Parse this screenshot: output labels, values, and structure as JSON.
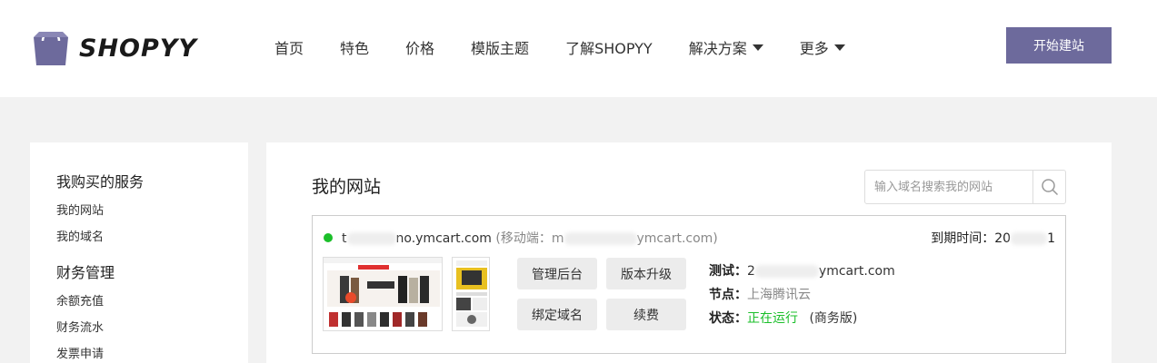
{
  "brand": {
    "name": "SHOPYY",
    "accent": "#6d6a9c"
  },
  "nav": {
    "items": [
      {
        "label": "首页"
      },
      {
        "label": "特色"
      },
      {
        "label": "价格"
      },
      {
        "label": "模版主题"
      },
      {
        "label": "了解SHOPYY"
      },
      {
        "label": "解决方案",
        "dropdown": true
      },
      {
        "label": "更多",
        "dropdown": true
      }
    ],
    "cta_label": "开始建站"
  },
  "sidebar": {
    "groups": [
      {
        "title": "我购买的服务",
        "links": [
          "我的网站",
          "我的域名"
        ]
      },
      {
        "title": "财务管理",
        "links": [
          "余额充值",
          "财务流水",
          "发票申请"
        ]
      }
    ]
  },
  "main": {
    "title": "我的网站",
    "search": {
      "placeholder": "输入域名搜索我的网站",
      "icon": "search-icon"
    },
    "site": {
      "domain_prefix": "t",
      "domain_suffix": "no.ymcart.com",
      "mobile_prefix": "(移动端：m",
      "mobile_suffix": "ymcart.com)",
      "expire_label": "到期时间：20",
      "expire_suffix": "1",
      "actions": [
        "管理后台",
        "版本升级",
        "绑定域名",
        "续费"
      ],
      "test_label": "测试：",
      "test_prefix": "2",
      "test_suffix": "ymcart.com",
      "node_label": "节点：",
      "node_value": "上海腾讯云",
      "status_label": "状态：",
      "status_value": "正在运行",
      "status_plan": "(商务版)",
      "status_color": "#1bbf2a"
    }
  }
}
